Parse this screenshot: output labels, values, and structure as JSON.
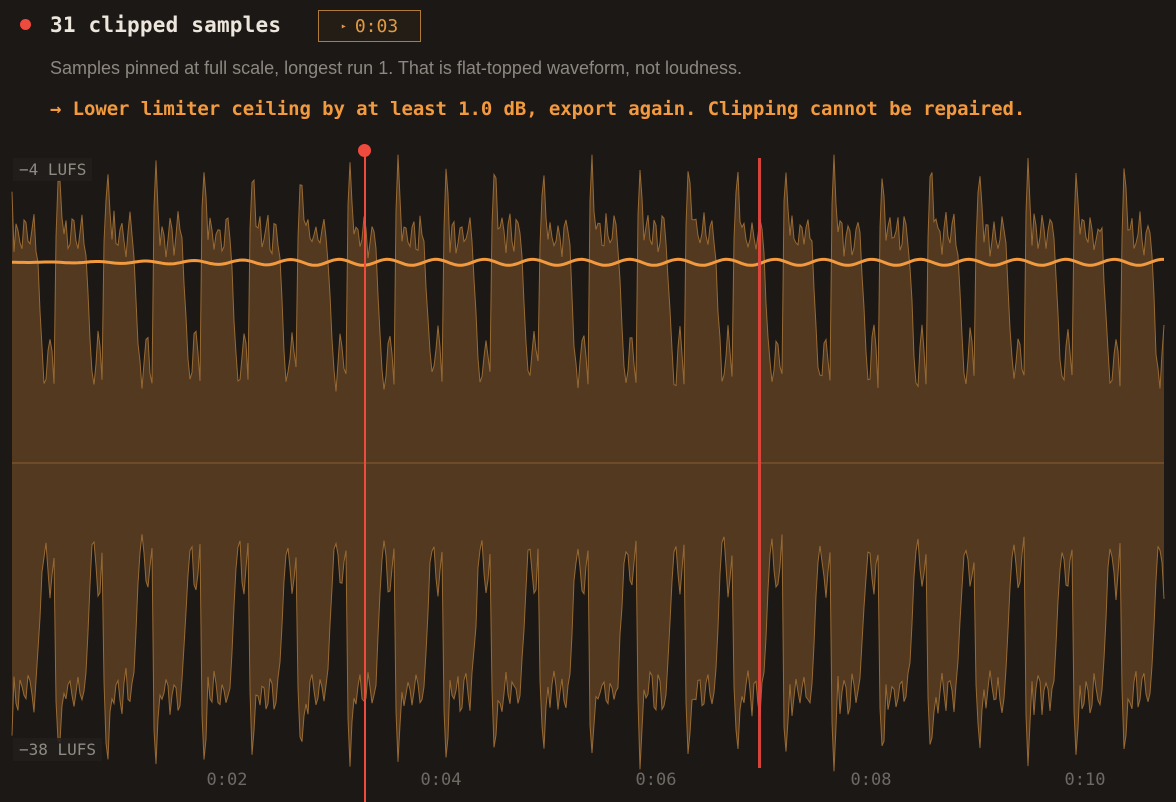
{
  "header": {
    "title": "31 clipped samples",
    "play_label": "0:03",
    "description": "Samples pinned at full scale, longest run 1. That is flat-topped waveform, not loudness.",
    "advice": "→ Lower limiter ceiling by at least 1.0 dB, export again. Clipping cannot be repaired."
  },
  "waveform": {
    "top_label": "−4 LUFS",
    "bottom_label": "−38 LUFS",
    "ticks": [
      "0:02",
      "0:04",
      "0:06",
      "0:08",
      "0:10"
    ],
    "duration_seconds": 10.7,
    "beat_seconds": 0.45,
    "playhead_seconds": 3.25,
    "clip_marker_seconds": 6.93,
    "loudness_lufs": -9.5,
    "colors": {
      "accent": "#f39a3f",
      "fill": "#5c3f22",
      "playhead": "#ef4a3e",
      "background": "#1c1815"
    }
  }
}
